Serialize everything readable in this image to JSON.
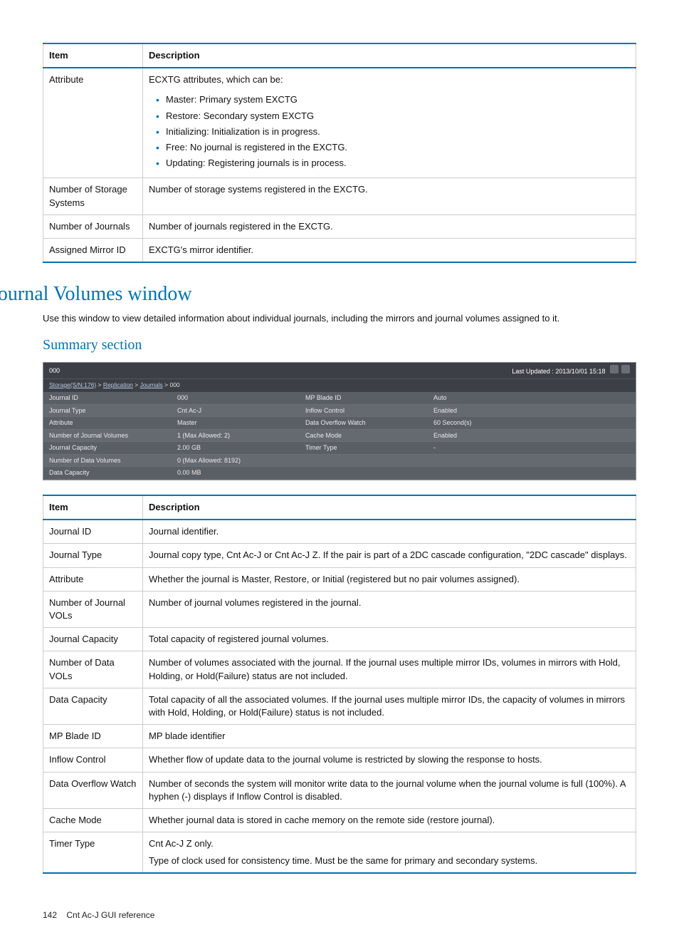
{
  "table1": {
    "headers": [
      "Item",
      "Description"
    ],
    "rows": [
      {
        "item": "Attribute",
        "desc": "ECXTG attributes, which can be:",
        "bullets": [
          "Master: Primary system EXCTG",
          "Restore: Secondary system EXCTG",
          "Initializing: Initialization is in progress.",
          "Free: No journal is registered in the EXCTG.",
          "Updating: Registering journals is in process."
        ]
      },
      {
        "item": "Number of Storage Systems",
        "desc": "Number of storage systems registered in the EXCTG."
      },
      {
        "item": "Number of Journals",
        "desc": "Number of journals registered in the EXCTG."
      },
      {
        "item": "Assigned Mirror ID",
        "desc": "EXCTG's mirror identifier."
      }
    ]
  },
  "section_title": "Journal Volumes window",
  "section_body": "Use this window to view detailed information about individual journals, including the mirrors and journal volumes assigned to it.",
  "subsection_title": "Summary section",
  "screenshot": {
    "title": "000",
    "updated_label": "Last Updated : 2013/10/01 15:18",
    "crumb": {
      "parts": [
        "Storage(S/N:176)",
        "Replication",
        "Journals"
      ],
      "tail": "000",
      "sep": " > "
    },
    "left": [
      [
        "Journal ID",
        "000"
      ],
      [
        "Journal Type",
        "Cnt Ac-J"
      ],
      [
        "Attribute",
        "Master"
      ],
      [
        "Number of Journal Volumes",
        "1 (Max Allowed: 2)"
      ],
      [
        "Journal Capacity",
        "2.00 GB"
      ],
      [
        "Number of Data Volumes",
        "0 (Max Allowed: 8192)"
      ],
      [
        "Data Capacity",
        "0.00 MB"
      ]
    ],
    "right": [
      [
        "MP Blade ID",
        "Auto"
      ],
      [
        "Inflow Control",
        "Enabled"
      ],
      [
        "Data Overflow Watch",
        "60 Second(s)"
      ],
      [
        "Cache Mode",
        "Enabled"
      ],
      [
        "Timer Type",
        "-"
      ]
    ]
  },
  "table2": {
    "headers": [
      "Item",
      "Description"
    ],
    "rows": [
      {
        "item": "Journal ID",
        "desc": "Journal identifier."
      },
      {
        "item": "Journal Type",
        "desc": "Journal copy type, Cnt Ac-J or Cnt Ac-J Z. If the pair is part of a 2DC cascade configuration, \"2DC cascade\" displays."
      },
      {
        "item": "Attribute",
        "desc": "Whether the journal is Master, Restore, or Initial (registered but no pair volumes assigned)."
      },
      {
        "item": "Number of Journal VOLs",
        "desc": "Number of journal volumes registered in the journal."
      },
      {
        "item": "Journal Capacity",
        "desc": "Total capacity of registered journal volumes."
      },
      {
        "item": "Number of Data VOLs",
        "desc": "Number of volumes associated with the journal. If the journal uses multiple mirror IDs, volumes in mirrors with Hold, Holding, or Hold(Failure) status are not included."
      },
      {
        "item": "Data Capacity",
        "desc": "Total capacity of all the associated volumes. If the journal uses multiple mirror IDs, the capacity of volumes in mirrors with Hold, Holding, or Hold(Failure) status is not included."
      },
      {
        "item": "MP Blade ID",
        "desc": "MP blade identifier"
      },
      {
        "item": "Inflow Control",
        "desc": "Whether flow of update data to the journal volume is restricted by slowing the response to hosts."
      },
      {
        "item": "Data Overflow Watch",
        "desc": "Number of seconds the system will monitor write data to the journal volume when the journal volume is full (100%). A hyphen (-) displays if Inflow Control is disabled."
      },
      {
        "item": "Cache Mode",
        "desc": "Whether journal data is stored in cache memory on the remote side (restore journal)."
      },
      {
        "item": "Timer Type",
        "desc_multi": [
          "Cnt Ac-J Z only.",
          "Type of clock used for consistency time. Must be the same for primary and secondary systems."
        ]
      }
    ]
  },
  "footer": {
    "page": "142",
    "label": "Cnt Ac-J GUI reference"
  }
}
